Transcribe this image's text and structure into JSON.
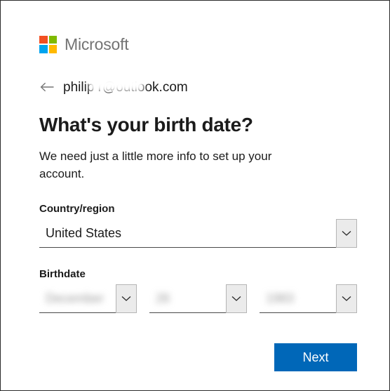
{
  "window": {
    "border_color": "#2b2b2b",
    "background": "#ffffff"
  },
  "brand": {
    "name": "Microsoft",
    "logo_colors": {
      "top_left": "#f25022",
      "top_right": "#7fba00",
      "bottom_left": "#00a4ef",
      "bottom_right": "#ffb900"
    }
  },
  "account": {
    "back_label": "Back",
    "email_visible_prefix": "philip r",
    "email_domain": "@outlook.com",
    "email_redacted": true
  },
  "main": {
    "heading": "What's your birth date?",
    "description": "We need just a little more info to set up your account."
  },
  "country_field": {
    "label": "Country/region",
    "value": "United States",
    "chevron": "chevron-down-icon"
  },
  "birthdate_field": {
    "label": "Birthdate",
    "month": {
      "value": "December",
      "redacted": true
    },
    "day": {
      "value": "26",
      "redacted": true
    },
    "year": {
      "value": "1983",
      "redacted": true
    }
  },
  "actions": {
    "next_label": "Next",
    "next_color": "#0067b8"
  }
}
